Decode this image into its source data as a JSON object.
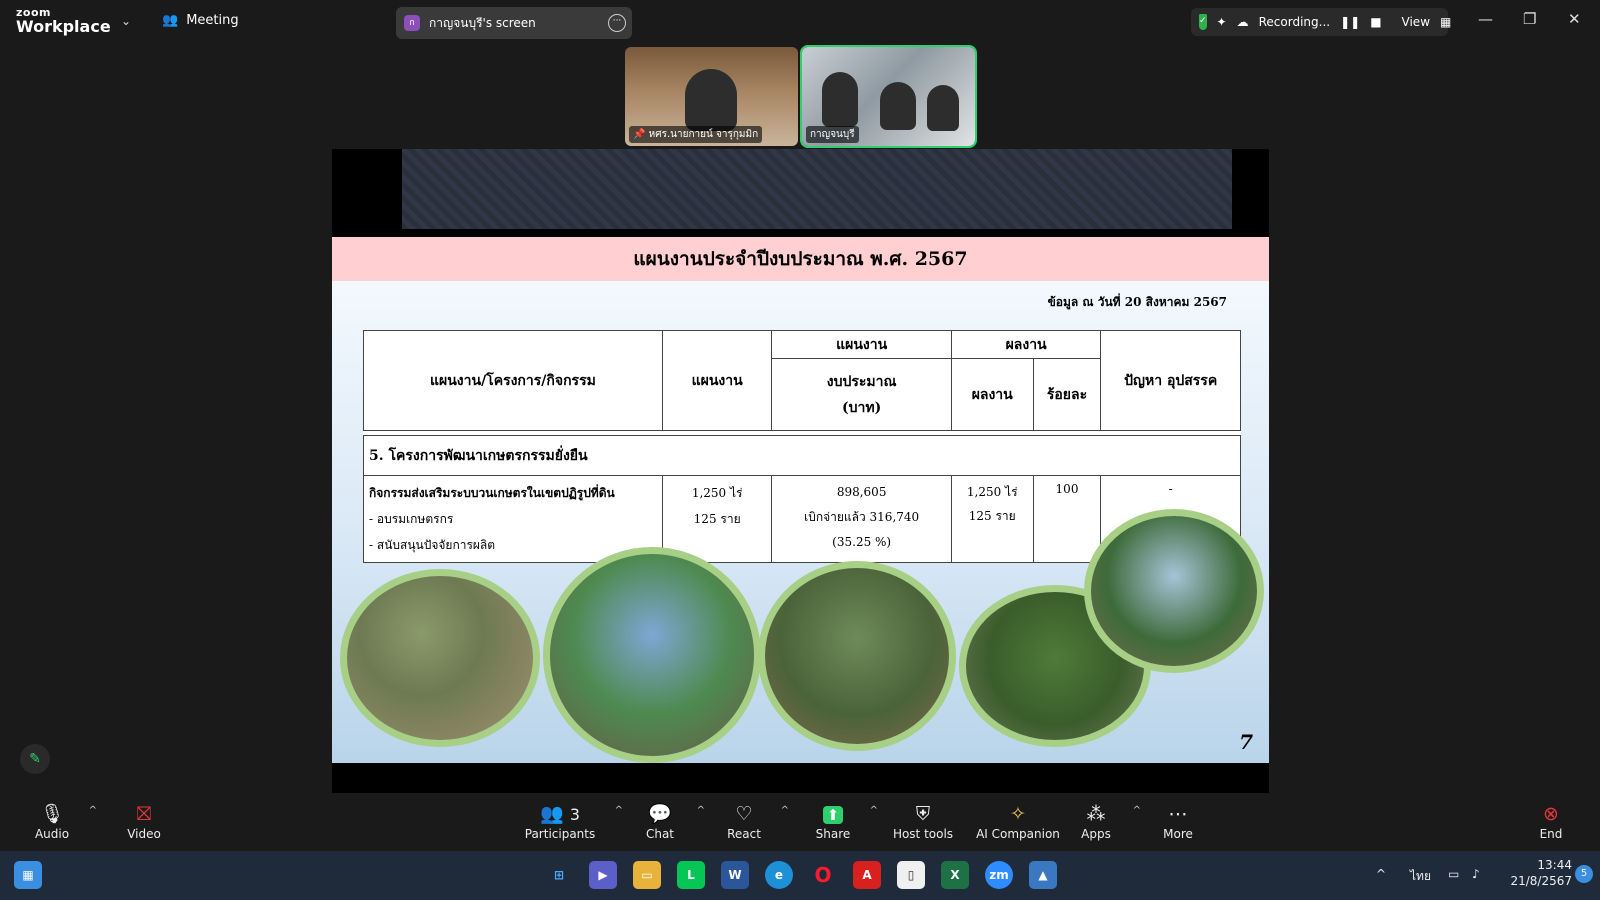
{
  "titlebar": {
    "brand_top": "zoom",
    "brand_bottom": "Workplace",
    "meeting_label": "Meeting",
    "share_avatar": "ก",
    "share_title": "กาญจนบุรี's screen",
    "recording_label": "Recording...",
    "view_label": "View"
  },
  "video": {
    "tiles": [
      {
        "name": "หศร.นายกายน์ จารุกุมมิก"
      },
      {
        "name": "กาญจนบุรี"
      }
    ]
  },
  "slide": {
    "title": "แผนงานประจำปีงบประมาณ พ.ศ. 2567",
    "date_note": "ข้อมูล ณ วันที่ 20 สิงหาคม 2567",
    "table": {
      "h_activity": "แผนงาน/โครงการ/กิจกรรม",
      "h_plan": "แผนงาน",
      "h_plan_group": "แผนงาน",
      "h_budget_line1": "งบประมาณ",
      "h_budget_line2": "(บาท)",
      "h_result_group": "ผลงาน",
      "h_result": "ผลงาน",
      "h_percent": "ร้อยละ",
      "h_problem": "ปัญหา อุปสรรค",
      "section": "5. โครงการพัฒนาเกษตรกรรมยั่งยืน",
      "row": {
        "activity": "กิจกรรมส่งเสริมระบบวนเกษตรในเขตปฏิรูปที่ดิน",
        "sub1": "- อบรมเกษตรกร",
        "sub2": "- สนับสนุนปัจจัยการผลิต",
        "plan_line1": "1,250 ไร่",
        "plan_line2": "125 ราย",
        "budget_line1": "898,605",
        "budget_line2": "เบิกจ่ายแล้ว  316,740",
        "budget_line3": "(35.25 %)",
        "result_line1": "1,250 ไร่",
        "result_line2": "125 ราย",
        "percent": "100",
        "problem": "-"
      }
    },
    "page_number": "7"
  },
  "toolbar": {
    "audio": "Audio",
    "video": "Video",
    "participants": "Participants",
    "participants_count": "3",
    "chat": "Chat",
    "react": "React",
    "share": "Share",
    "host_tools": "Host tools",
    "ai_companion": "AI Companion",
    "apps": "Apps",
    "more": "More",
    "end": "End"
  },
  "taskbar": {
    "language": "ไทย",
    "time": "13:44",
    "date": "21/8/2567",
    "notification_count": "5"
  },
  "colors": {
    "share_green": "#2ed06e",
    "end_red": "#e5363d",
    "slide_title_bg": "#ffcfd2"
  }
}
